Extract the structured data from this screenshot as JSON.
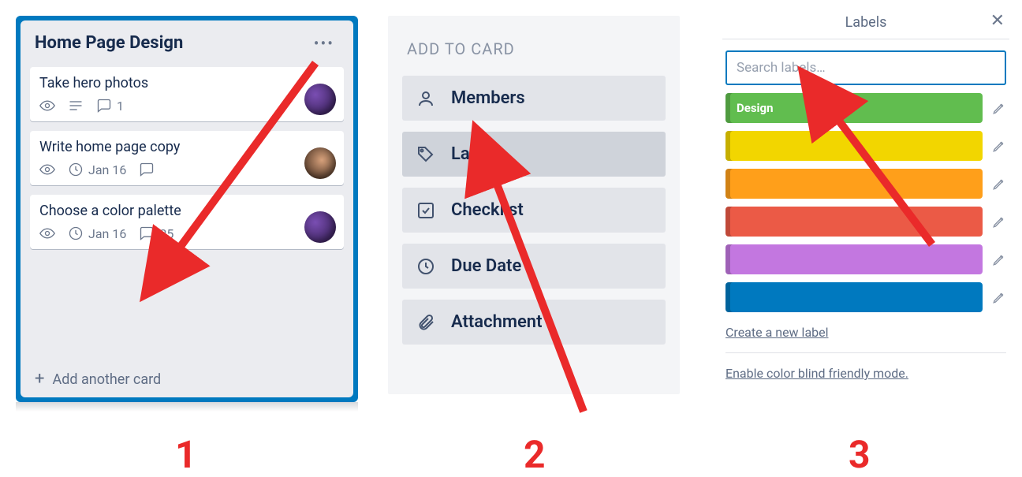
{
  "list": {
    "title": "Home Page Design",
    "add_label": "Add another card",
    "cards": [
      {
        "title": "Take hero photos",
        "comments": "1"
      },
      {
        "title": "Write home page copy",
        "due": "Jan 16"
      },
      {
        "title": "Choose a color palette",
        "due": "Jan 16",
        "comments": "25"
      }
    ]
  },
  "addToCard": {
    "heading": "ADD TO CARD",
    "items": [
      "Members",
      "Labels",
      "Checklist",
      "Due Date",
      "Attachment"
    ]
  },
  "labelsPopover": {
    "title": "Labels",
    "search_placeholder": "Search labels…",
    "labels": [
      {
        "name": "Design",
        "color": "#61bd4f"
      },
      {
        "name": "",
        "color": "#f2d600"
      },
      {
        "name": "",
        "color": "#ff9f1a"
      },
      {
        "name": "",
        "color": "#eb5a46"
      },
      {
        "name": "",
        "color": "#c377e0"
      },
      {
        "name": "",
        "color": "#0079bf"
      }
    ],
    "create_link": "Create a new label",
    "cb_link": "Enable color blind friendly mode."
  },
  "steps": [
    "1",
    "2",
    "3"
  ]
}
